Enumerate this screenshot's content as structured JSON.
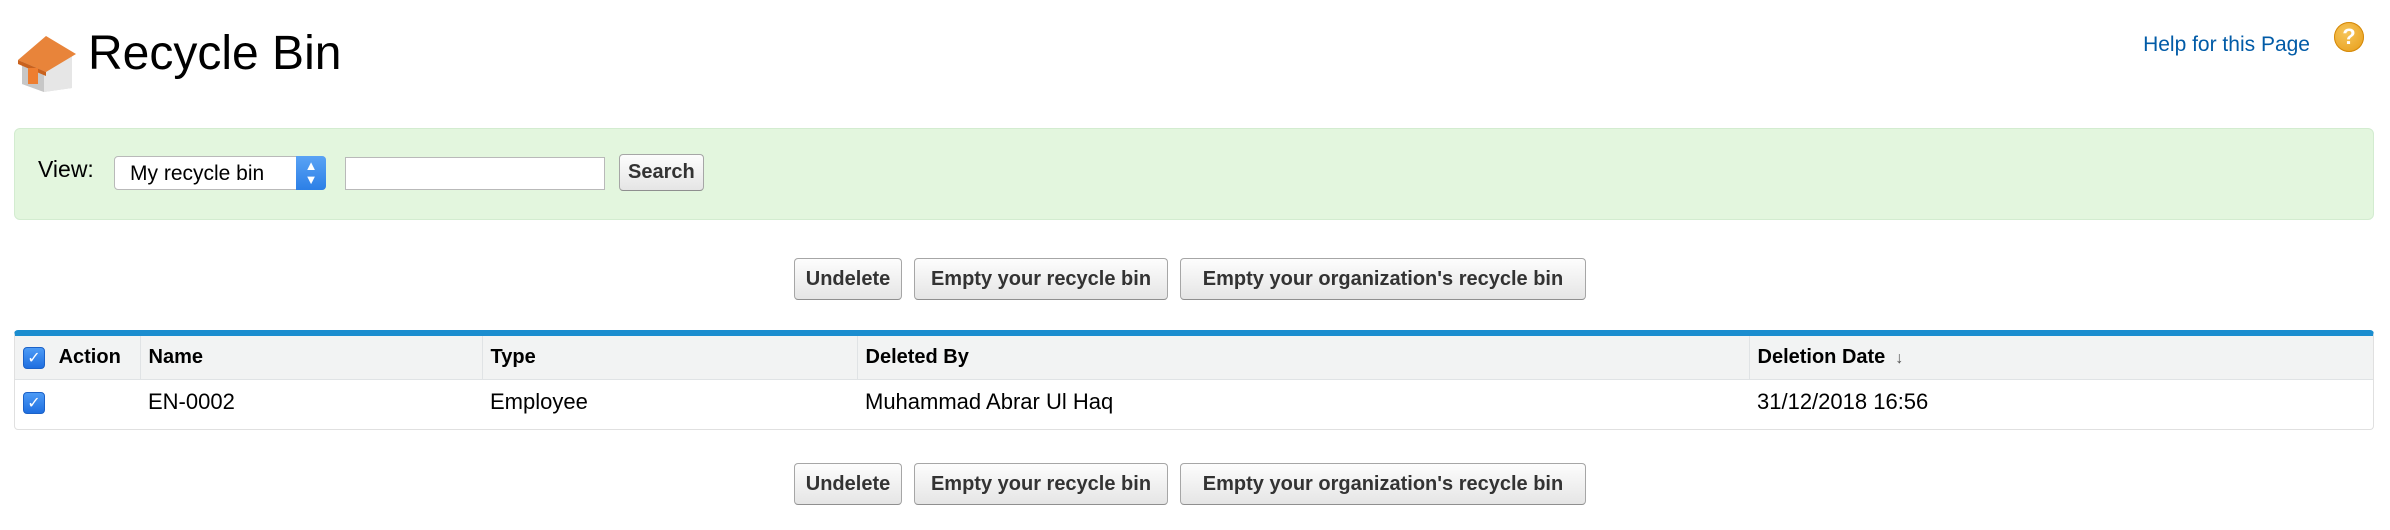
{
  "header": {
    "title": "Recycle Bin",
    "icon": "house-icon",
    "help_link": "Help for this Page",
    "help_icon": "question-icon"
  },
  "filter": {
    "view_label": "View:",
    "view_selected": "My recycle bin",
    "search_value": "",
    "search_button": "Search"
  },
  "actions": {
    "undelete": "Undelete",
    "empty_mine": "Empty your recycle bin",
    "empty_org": "Empty your organization's recycle bin"
  },
  "table": {
    "columns": [
      "Action",
      "Name",
      "Type",
      "Deleted By",
      "Deletion Date"
    ],
    "sort_indicator": "↓",
    "select_all_checked": true,
    "rows": [
      {
        "checked": true,
        "name": "EN-0002",
        "type": "Employee",
        "deleted_by": "Muhammad Abrar Ul Haq",
        "deletion_date": "31/12/2018 16:56"
      }
    ]
  },
  "colors": {
    "filter_bg": "#e3f6de",
    "table_accent": "#1b8dcf",
    "link": "#015ba7",
    "help_icon": "#e79b14"
  }
}
